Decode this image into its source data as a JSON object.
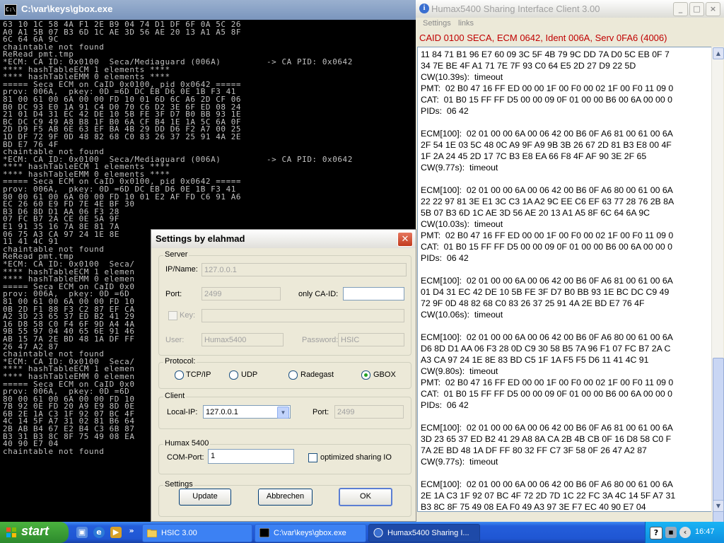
{
  "console": {
    "title": "C:\\var\\keys\\gbox.exe",
    "lines": [
      "63 10 1C 58 4A F1 2E B9 04 74 D1 DF 6F 0A 5C 26",
      "A0 A1 5B 07 B3 6D 1C AE 3D 56 AE 20 13 A1 A5 8F",
      "6C 64 6A 9C",
      "chaintable not found",
      "ReRead pmt.tmp",
      "*ECM: CA ID: 0x0100  Seca/Mediaguard (006A)         -> CA PID: 0x0642",
      "**** hashTableECM 1 elements ****",
      "**** hashTableEMM 0 elements ****",
      "===== Seca ECM on CaID 0x0100, pid 0x0642 =====",
      "prov: 006A,  pkey: 0D =6D DC EB D6 0E 1B F3 41",
      "81 00 61 00 6A 00 00 FD 10 01 6D 6C A6 2D CF 06",
      "B0 DC 93 E0 1A 91 C4 D0 70 C6 D2 3E 6F ED 08 24",
      "21 01 D4 31 EC 42 DE 10 5B FE 3F D7 B0 BB 93 1E",
      "BC DC C9 49 A8 B8 1F B0 6A CF B4 1E 1A 5C 6A 0F",
      "2D D9 F5 AB 6E 63 EF BA 4B 29 DD D6 F2 A7 00 25",
      "1D DF 72 9F 0D 48 82 68 C0 83 26 37 25 91 4A 2E",
      "BD E7 76 4F",
      "chaintable not found",
      "*ECM: CA ID: 0x0100  Seca/Mediaguard (006A)         -> CA PID: 0x0642",
      "**** hashTableECM 1 elements ****",
      "**** hashTableEMM 0 elements ****",
      "===== Seca ECM on CaID 0x0100, pid 0x0642 =====",
      "prov: 006A,  pkey: 0D =6D DC EB D6 0E 1B F3 41",
      "80 00 61 00 6A 00 00 FD 10 01 E2 AF FD C6 91 A6",
      "EC 26 60 E9 FD 7E 4E BF 30",
      "B3 D6 8D D1 AA 06 F3 28",
      "07 FC B7 2A CE 0E 5A 9F",
      "E1 91 35 16 7A 8E 81 7A",
      "06 75 A3 CA 97 24 1E 8E",
      "11 41 4C 91",
      "chaintable not found",
      "ReRead pmt.tmp",
      "*ECM: CA ID: 0x0100  Seca/",
      "**** hashTableECM 1 elemen",
      "**** hashTableEMM 0 elemen",
      "===== Seca ECM on CaID 0x0",
      "prov: 006A,  pkey: 0D =6D",
      "81 00 61 00 6A 00 00 FD 10",
      "0B 2D F1 88 F3 C2 87 EF CA",
      "A2 3D 23 65 37 ED B2 41 29",
      "16 D8 58 C0 F4 6F 9D A4 4A",
      "9B 55 97 04 40 65 6E 91 46",
      "AB 15 7A 2E BD 48 1A DF FF",
      "26 47 A2 87",
      "chaintable not found",
      "*ECM: CA ID: 0x0100  Seca/",
      "**** hashTableECM 1 elemen",
      "**** hashTableEMM 0 elemen",
      "===== Seca ECM on CaID 0x0",
      "prov: 006A,  pkey: 0D =6D",
      "80 00 61 00 6A 00 00 FD 10",
      "7B 92 0E FD 20 A9 E9 8D 0E",
      "6B 2E 1A C3 1F 92 07 BC 4F",
      "4C 14 5F A7 31 02 81 B6 64",
      "2B AB B4 67 E2 B4 C3 6B 87",
      "B3 31 B3 8C 8F 75 49 08 EA",
      "40 90 E7 04",
      "chaintable not found"
    ]
  },
  "client": {
    "title": "Humax5400 Sharing Interface Client 3.00",
    "menu": [
      "Settings",
      "links"
    ],
    "status": "CAID 0100 SECA, ECM 0642, Ident 006A, Serv 0FA6 (4006)",
    "log": [
      "11 84 71 B1 96 E7 60 09 3C 5F 4B 79 9C DD 7A D0 5C EB 0F 7",
      "34 7E BE 4F A1 71 7E 7F 93 C0 64 E5 2D 27 D9 22 5D",
      "CW(10.39s):  timeout",
      "PMT:  02 B0 47 16 FF ED 00 00 1F 00 F0 00 02 1F 00 F0 11 09 0",
      "CAT:  01 B0 15 FF FF D5 00 00 09 0F 01 00 00 B6 00 6A 00 00 0",
      "PIDs:  06 42",
      "",
      "ECM[100]:  02 01 00 00 6A 00 06 42 00 B6 0F A6 81 00 61 00 6A",
      "2F 54 1E 03 5C 48 0C A9 9F A9 9B 3B 26 67 2D 81 B3 E8 00 4F",
      "1F 2A 24 45 2D 17 7C B3 E8 EA 66 F8 4F AF 90 3E 2F 65",
      "CW(9.77s):  timeout",
      "",
      "ECM[100]:  02 01 00 00 6A 00 06 42 00 B6 0F A6 80 00 61 00 6A",
      "22 22 97 81 3E E1 3C C3 1A A2 9C EE C6 EF 63 77 28 76 2B 8A",
      "5B 07 B3 6D 1C AE 3D 56 AE 20 13 A1 A5 8F 6C 64 6A 9C",
      "CW(10.03s):  timeout",
      "PMT:  02 B0 47 16 FF ED 00 00 1F 00 F0 00 02 1F 00 F0 11 09 0",
      "CAT:  01 B0 15 FF FF D5 00 00 09 0F 01 00 00 B6 00 6A 00 00 0",
      "PIDs:  06 42",
      "",
      "ECM[100]:  02 01 00 00 6A 00 06 42 00 B6 0F A6 81 00 61 00 6A",
      "01 D4 31 EC 42 DE 10 5B FE 3F D7 B0 BB 93 1E BC DC C9 49",
      "72 9F 0D 48 82 68 C0 83 26 37 25 91 4A 2E BD E7 76 4F",
      "CW(10.06s):  timeout",
      "",
      "ECM[100]:  02 01 00 00 6A 00 06 42 00 B6 0F A6 80 00 61 00 6A",
      "D6 8D D1 AA 06 F3 28 0D C9 30 58 B5 7A 96 F1 07 FC B7 2A C",
      "A3 CA 97 24 1E 8E 83 BD C5 1F 1A F5 F5 D6 11 41 4C 91",
      "CW(9.80s):  timeout",
      "PMT:  02 B0 47 16 FF ED 00 00 1F 00 F0 00 02 1F 00 F0 11 09 0",
      "CAT:  01 B0 15 FF FF D5 00 00 09 0F 01 00 00 B6 00 6A 00 00 0",
      "PIDs:  06 42",
      "",
      "ECM[100]:  02 01 00 00 6A 00 06 42 00 B6 0F A6 81 00 61 00 6A",
      "3D 23 65 37 ED B2 41 29 A8 8A CA 2B 4B CB 0F 16 D8 58 C0 F",
      "7A 2E BD 48 1A DF FF 80 32 FF C7 3F 58 0F 26 47 A2 87",
      "CW(9.77s):  timeout",
      "",
      "ECM[100]:  02 01 00 00 6A 00 06 42 00 B6 0F A6 80 00 61 00 6A",
      "2E 1A C3 1F 92 07 BC 4F 72 2D 7D 1C 22 FC 3A 4C 14 5F A7 31",
      "B3 8C 8F 75 49 08 EA F0 49 A3 97 3E F7 EC 40 90 E7 04"
    ]
  },
  "dialog": {
    "title": "Settings by elahmad",
    "server": {
      "group": "Server",
      "ip_label": "IP/Name:",
      "ip_value": "127.0.0.1",
      "port_label": "Port:",
      "port_value": "2499",
      "caid_label": "only CA-ID:",
      "caid_value": "",
      "key_label": "Key:",
      "key_value": "",
      "user_label": "User:",
      "user_value": "Humax5400",
      "password_label": "Password:",
      "password_value": "HSIC"
    },
    "protocol": {
      "group": "Protocol:",
      "options": [
        "TCP/IP",
        "UDP",
        "Radegast",
        "GBOX"
      ],
      "selected": "GBOX"
    },
    "client": {
      "group": "Client",
      "localip_label": "Local-IP:",
      "localip_value": "127.0.0.1",
      "port_label": "Port:",
      "port_value": "2499"
    },
    "humax": {
      "group": "Humax 5400",
      "comport_label": "COM-Port:",
      "comport_value": "1",
      "optimized_label": "optimized sharing IO"
    },
    "settings": {
      "group": "Settings",
      "update": "Update",
      "cancel": "Abbrechen",
      "ok": "OK"
    }
  },
  "taskbar": {
    "start": "start",
    "more": "»",
    "tasks": [
      {
        "label": "HSIC 3.00",
        "icon": "folder-icon"
      },
      {
        "label": "C:\\var\\keys\\gbox.exe",
        "icon": "console-icon"
      },
      {
        "label": "Humax5400 Sharing I...",
        "icon": "info-icon"
      }
    ],
    "clock": "16:47"
  }
}
